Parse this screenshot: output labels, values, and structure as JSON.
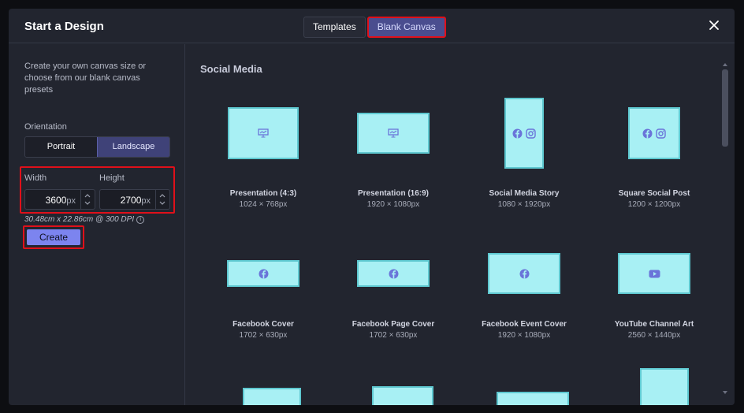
{
  "header": {
    "title": "Start a Design",
    "tabs": [
      {
        "label": "Templates"
      },
      {
        "label": "Blank Canvas"
      }
    ]
  },
  "sidebar": {
    "description": "Create your own canvas size or choose from our blank canvas presets",
    "orientation_label": "Orientation",
    "orientation_options": [
      "Portrait",
      "Landscape"
    ],
    "orientation_selected": "Landscape",
    "width_label": "Width",
    "width_value": "3600",
    "width_unit": "px",
    "height_label": "Height",
    "height_value": "2700",
    "height_unit": "px",
    "dpi_text": "30.48cm x 22.86cm @ 300 DPI",
    "create_label": "Create"
  },
  "content": {
    "section_title": "Social Media",
    "presets": [
      {
        "name": "Presentation (4:3)",
        "size": "1024 × 768px",
        "icon": "presentation-icon"
      },
      {
        "name": "Presentation (16:9)",
        "size": "1920 × 1080px",
        "icon": "presentation-icon"
      },
      {
        "name": "Social Media Story",
        "size": "1080 × 1920px",
        "icon": "facebook-instagram-icons"
      },
      {
        "name": "Square Social Post",
        "size": "1200 × 1200px",
        "icon": "facebook-instagram-icons"
      },
      {
        "name": "Facebook Cover",
        "size": "1702 × 630px",
        "icon": "facebook-icon"
      },
      {
        "name": "Facebook Page Cover",
        "size": "1702 × 630px",
        "icon": "facebook-icon"
      },
      {
        "name": "Facebook Event Cover",
        "size": "1920 × 1080px",
        "icon": "facebook-icon"
      },
      {
        "name": "YouTube Channel Art",
        "size": "2560 × 1440px",
        "icon": "youtube-icon"
      }
    ]
  },
  "colors": {
    "accent": "#7c84ef",
    "preset_fill": "#a8f0f4",
    "highlight": "#e0101a",
    "background": "#22252f"
  }
}
